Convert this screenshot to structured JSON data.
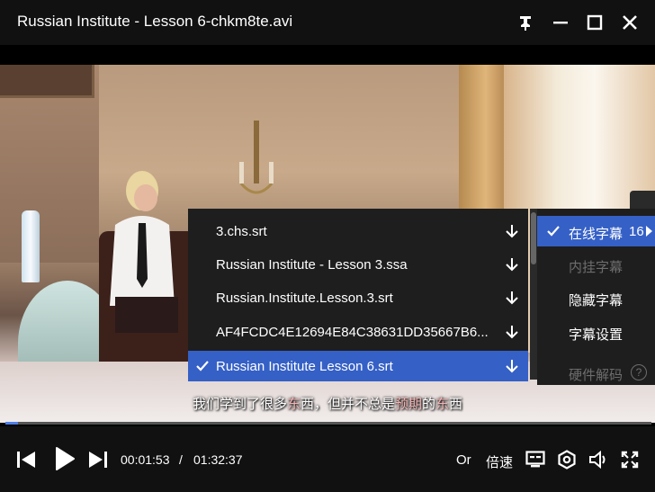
{
  "window": {
    "title": "Russian Institute - Lesson 6-chkm8te.avi",
    "buttons": [
      "pin-icon",
      "minimize-icon",
      "maximize-icon",
      "close-icon"
    ]
  },
  "video": {
    "subtitle_parts": [
      "我们学到了很多",
      "东",
      "西，但并不总是",
      "预期",
      "的",
      "东",
      "西"
    ]
  },
  "progress": {
    "fraction": 0.019
  },
  "controls": {
    "current_time": "00:01:53",
    "separator": "/",
    "total_time": "01:32:37",
    "original_label": "Or",
    "speed_label": "倍速"
  },
  "subtitle_menu": {
    "items": [
      {
        "label": "3.chs.srt",
        "selected": false
      },
      {
        "label": "Russian Institute - Lesson 3.ssa",
        "selected": false
      },
      {
        "label": "Russian.Institute.Lesson.3.srt",
        "selected": false
      },
      {
        "label": "AF4FCDC4E12694E84C38631DD35667B6...",
        "selected": false
      },
      {
        "label": "Russian Institute Lesson 6.srt",
        "selected": true
      }
    ]
  },
  "subtitle_submenu": {
    "online": {
      "label": "在线字幕",
      "count": "16",
      "checked": true
    },
    "embedded": {
      "label": "内挂字幕",
      "disabled": true
    },
    "hide": {
      "label": "隐藏字幕"
    },
    "settings": {
      "label": "字幕设置"
    },
    "hw_decode": {
      "label": "硬件解码",
      "disabled": true
    }
  },
  "colors": {
    "accent": "#3560c6",
    "progress": "#4f7fe8",
    "menu_bg": "#1e1e1e"
  }
}
